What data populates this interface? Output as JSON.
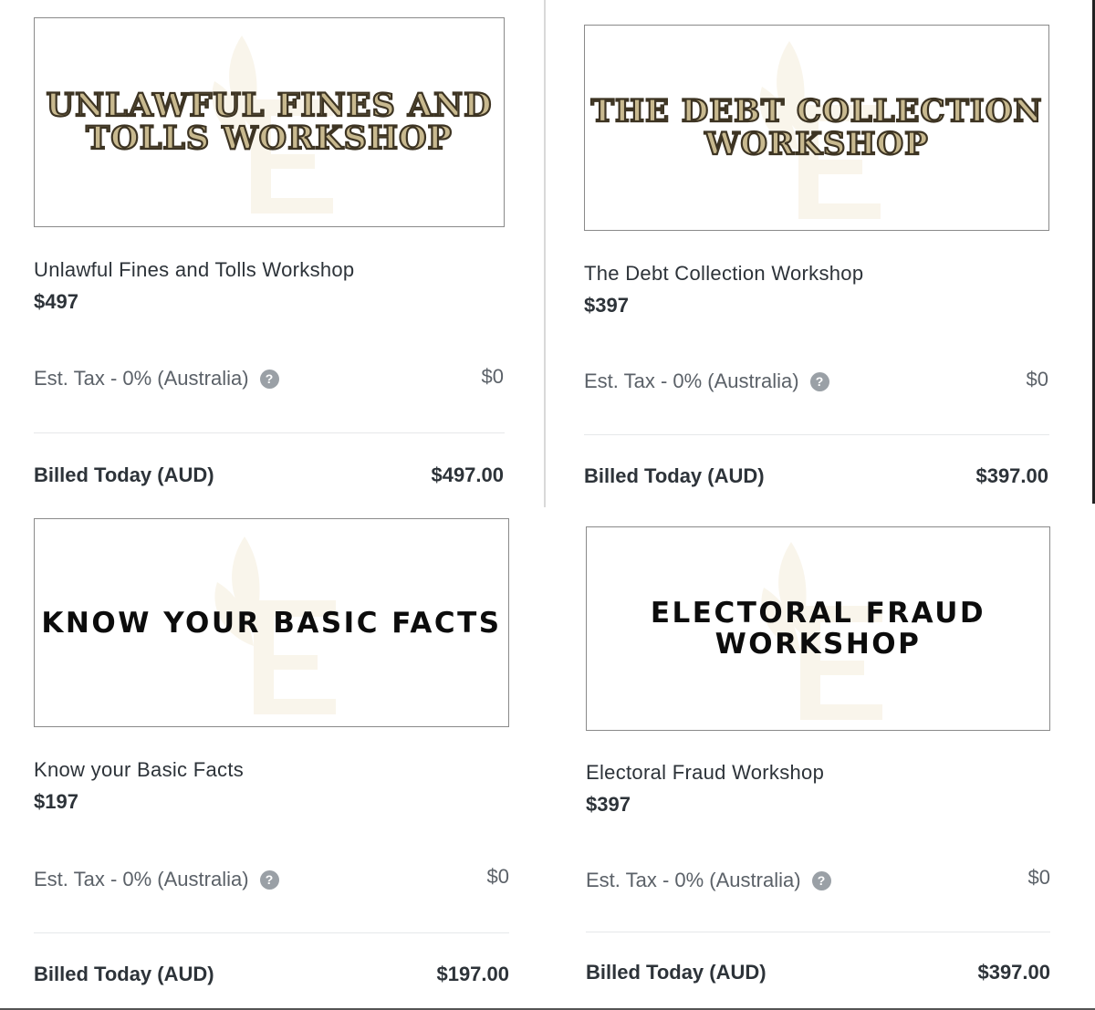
{
  "cards": [
    {
      "banner_text": "UNLAWFUL FINES AND TOLLS WORKSHOP",
      "banner_line1": "UNLAWFUL FINES AND",
      "banner_line2": "TOLLS WORKSHOP",
      "banner_style": "gold",
      "product_name": "Unlawful Fines and Tolls Workshop",
      "price": "$497",
      "tax_label": "Est. Tax - 0% (Australia)",
      "tax_value": "$0",
      "billed_label": "Billed Today (AUD)",
      "billed_value": "$497.00"
    },
    {
      "banner_text": "THE DEBT COLLECTION WORKSHOP",
      "banner_line1": "THE DEBT COLLECTION",
      "banner_line2": "WORKSHOP",
      "banner_style": "gold",
      "product_name": "The Debt Collection Workshop",
      "price": "$397",
      "tax_label": "Est. Tax - 0% (Australia)",
      "tax_value": "$0",
      "billed_label": "Billed Today (AUD)",
      "billed_value": "$397.00"
    },
    {
      "banner_text": "KNOW YOUR BASIC FACTS",
      "banner_line1": "KNOW YOUR BASIC FACTS",
      "banner_line2": "",
      "banner_style": "black",
      "product_name": "Know your Basic Facts",
      "price": "$197",
      "tax_label": "Est. Tax - 0% (Australia)",
      "tax_value": "$0",
      "billed_label": "Billed Today (AUD)",
      "billed_value": "$197.00"
    },
    {
      "banner_text": "ELECTORAL FRAUD WORKSHOP",
      "banner_line1": "ELECTORAL FRAUD",
      "banner_line2": "WORKSHOP",
      "banner_style": "black",
      "product_name": "Electoral Fraud Workshop",
      "price": "$397",
      "tax_label": "Est. Tax - 0% (Australia)",
      "tax_value": "$0",
      "billed_label": "Billed Today (AUD)",
      "billed_value": "$397.00"
    }
  ],
  "icons": {
    "help": "question-circle-icon",
    "watermark": "leaf-logo-watermark"
  },
  "colors": {
    "gold_fill": "#c8b98f",
    "gold_outline": "#3d3423",
    "text_dark": "#2d3339",
    "text_muted": "#5b6168",
    "help_icon": "#9aa0a6"
  }
}
